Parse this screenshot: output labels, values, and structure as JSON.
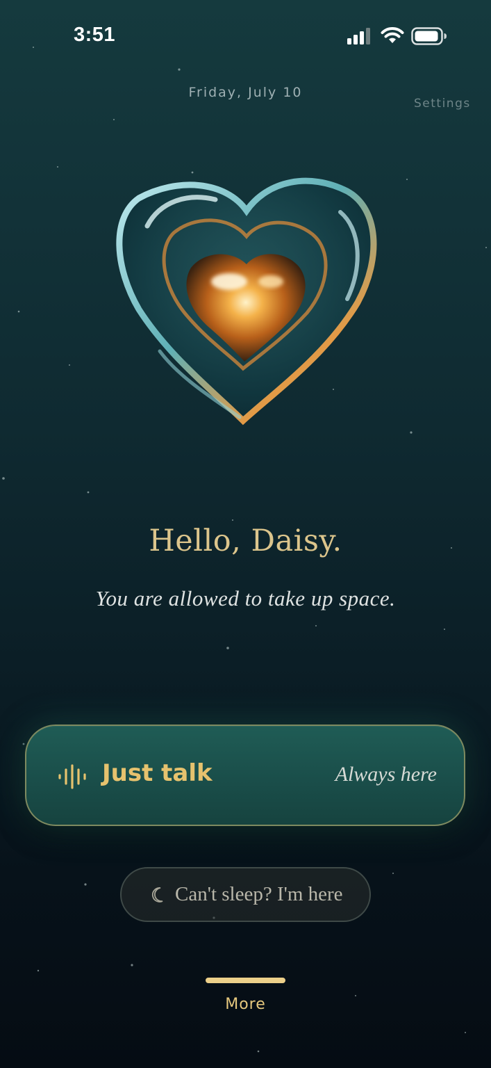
{
  "status_bar": {
    "time": "3:51",
    "icons": [
      "cellular-signal-icon",
      "wifi-icon",
      "battery-icon"
    ]
  },
  "header": {
    "date": "Friday, July 10",
    "settings_label": "Settings"
  },
  "hero": {
    "icon": "glass-heart-icon"
  },
  "greeting": {
    "title": "Hello, Daisy.",
    "affirmation": "You are allowed to take up space."
  },
  "primary_action": {
    "label": "Just talk",
    "subtitle": "Always here",
    "icon": "waveform-icon"
  },
  "secondary_action": {
    "label": "Can't sleep? I'm here",
    "icon": "moon-icon"
  },
  "bottom_nav": {
    "more_label": "More"
  },
  "colors": {
    "accent_gold": "#e6c26e",
    "primary_button_bg": "#1f5c55",
    "background_top": "#153a3e",
    "background_bottom": "#050c13"
  }
}
